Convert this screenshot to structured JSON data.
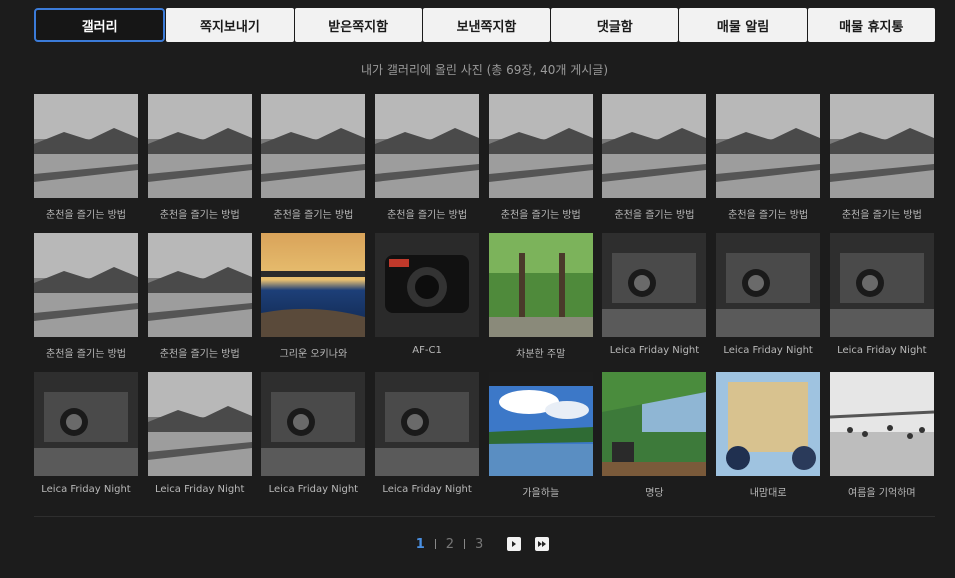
{
  "tabs": [
    {
      "label": "갤러리",
      "active": true
    },
    {
      "label": "쪽지보내기",
      "active": false
    },
    {
      "label": "받은쪽지함",
      "active": false
    },
    {
      "label": "보낸쪽지함",
      "active": false
    },
    {
      "label": "댓글함",
      "active": false
    },
    {
      "label": "매물 알림",
      "active": false
    },
    {
      "label": "매물 휴지통",
      "active": false
    }
  ],
  "summary": "내가 갤러리에 올린 사진 (총 69장, 40개 게시글)",
  "gallery": [
    {
      "caption": "춘천을 즐기는 방법",
      "tone": "bw"
    },
    {
      "caption": "춘천을 즐기는 방법",
      "tone": "bw"
    },
    {
      "caption": "춘천을 즐기는 방법",
      "tone": "bw"
    },
    {
      "caption": "춘천을 즐기는 방법",
      "tone": "bw"
    },
    {
      "caption": "춘천을 즐기는 방법",
      "tone": "bw"
    },
    {
      "caption": "춘천을 즐기는 방법",
      "tone": "bw"
    },
    {
      "caption": "춘천을 즐기는 방법",
      "tone": "bw"
    },
    {
      "caption": "춘천을 즐기는 방법",
      "tone": "bw"
    },
    {
      "caption": "춘천을 즐기는 방법",
      "tone": "bw"
    },
    {
      "caption": "춘천을 즐기는 방법",
      "tone": "bw"
    },
    {
      "caption": "그리운 오키나와",
      "tone": "sunset"
    },
    {
      "caption": "AF-C1",
      "tone": "camera"
    },
    {
      "caption": "차분한 주말",
      "tone": "green"
    },
    {
      "caption": "Leica Friday Night",
      "tone": "bw-dark"
    },
    {
      "caption": "Leica Friday Night",
      "tone": "bw-dark"
    },
    {
      "caption": "Leica Friday Night",
      "tone": "bw-dark"
    },
    {
      "caption": "Leica Friday Night",
      "tone": "bw-dark"
    },
    {
      "caption": "Leica Friday Night",
      "tone": "bw"
    },
    {
      "caption": "Leica Friday Night",
      "tone": "bw-dark"
    },
    {
      "caption": "Leica Friday Night",
      "tone": "bw-dark"
    },
    {
      "caption": "가을하늘",
      "tone": "sky"
    },
    {
      "caption": "명당",
      "tone": "lake"
    },
    {
      "caption": "내맘대로",
      "tone": "glass"
    },
    {
      "caption": "여름을 기억하며",
      "tone": "bw-light"
    }
  ],
  "pagination": {
    "pages": [
      "1",
      "2",
      "3"
    ],
    "current": "1",
    "next_icon": "next-page-icon",
    "last_icon": "last-page-icon"
  },
  "colors": {
    "background": "#1c1c1c",
    "active_tab_border": "#3b7bd8",
    "current_page": "#4a90e2"
  }
}
